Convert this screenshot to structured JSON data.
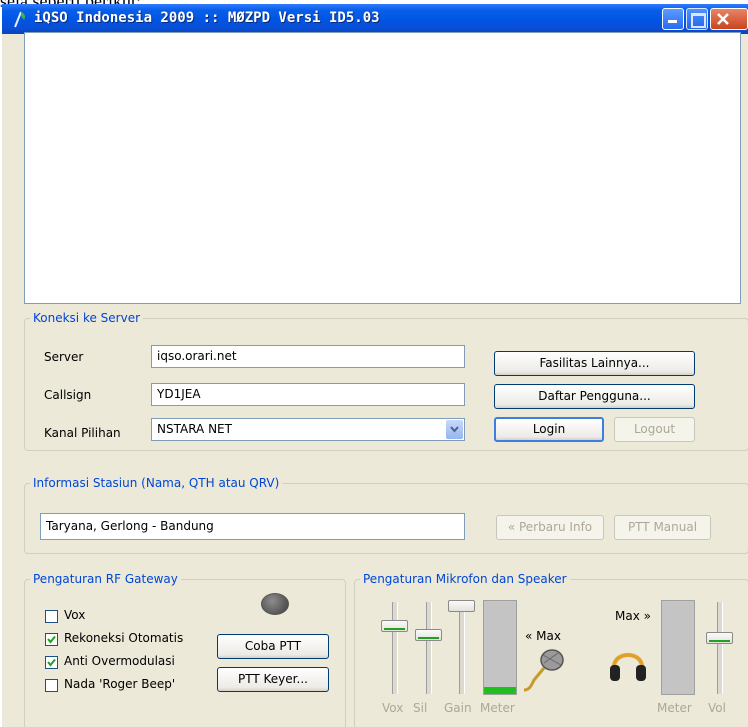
{
  "page_top_text": "sela seperti berikut:",
  "window": {
    "title": "iQSO Indonesia 2009 :: MØZPD Versi ID5.03"
  },
  "koneksi": {
    "legend": "Koneksi ke Server",
    "server_label": "Server",
    "server_value": "iqso.orari.net",
    "callsign_label": "Callsign",
    "callsign_value": "YD1JEA",
    "kanal_label": "Kanal Pilihan",
    "kanal_value": "NSTARA NET",
    "fasilitas_button": "Fasilitas Lainnya...",
    "daftar_button": "Daftar Pengguna...",
    "login_button": "Login",
    "logout_button": "Logout"
  },
  "informasi": {
    "legend": "Informasi Stasiun (Nama, QTH atau QRV)",
    "value": "Taryana, Gerlong - Bandung",
    "perbaru_button": "« Perbaru Info",
    "ptt_manual_button": "PTT Manual"
  },
  "rf_gateway": {
    "legend": "Pengaturan RF Gateway",
    "checkboxes": [
      {
        "label": "Vox",
        "checked": false
      },
      {
        "label": "Rekoneksi Otomatis",
        "checked": true
      },
      {
        "label": "Anti Overmodulasi",
        "checked": true
      },
      {
        "label": "Nada 'Roger Beep'",
        "checked": false
      }
    ],
    "coba_ptt_button": "Coba PTT",
    "ptt_keyer_button": "PTT Keyer..."
  },
  "mikrofon": {
    "legend": "Pengaturan Mikrofon dan Speaker",
    "mic_max": "« Max",
    "spk_max": "Max »",
    "captions": {
      "vox": "Vox",
      "sil": "Sil",
      "gain": "Gain",
      "meter": "Meter",
      "meter2": "Meter",
      "vol": "Vol"
    },
    "mic_meter_level": 0.08,
    "vox_level": 0.78,
    "sil_level": 0.68,
    "gain_level": 1.0,
    "vol_level": 0.65
  },
  "colors": {
    "accent": "#0046d5",
    "titlebar": "#0055e5",
    "meter_fill": "#1fbf1f"
  }
}
